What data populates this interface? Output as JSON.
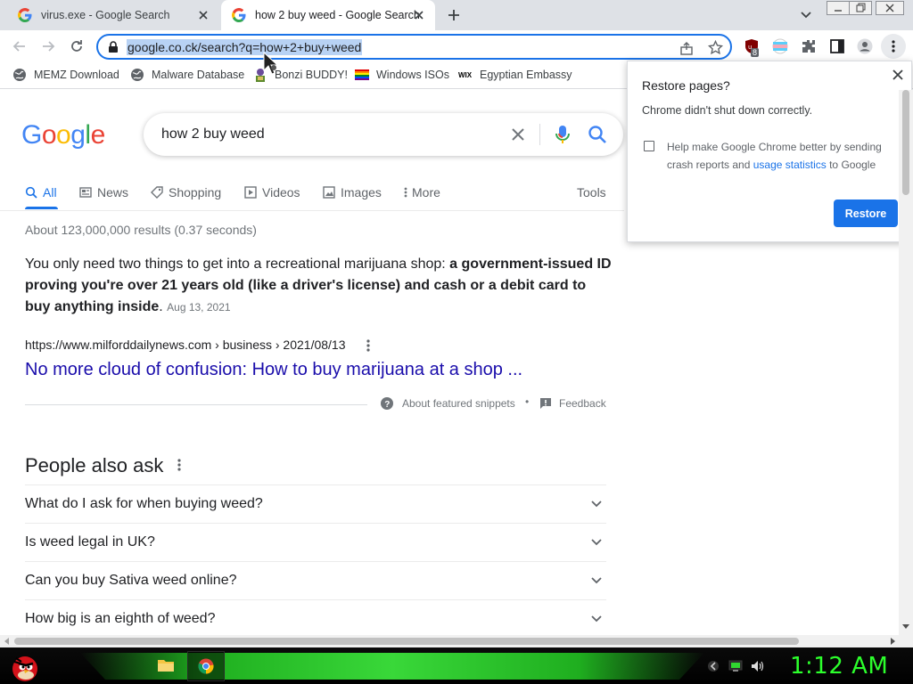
{
  "tabs": [
    {
      "title": "virus.exe - Google Search",
      "active": false
    },
    {
      "title": "how 2 buy weed - Google Search",
      "active": true
    }
  ],
  "omnibox": {
    "url": "google.co.ck/search?q=how+2+buy+weed"
  },
  "extensions": {
    "badge_count": "8"
  },
  "bookmarks": [
    {
      "label": "MEMZ Download",
      "icon": "globe-icon"
    },
    {
      "label": "Malware Database",
      "icon": "globe-icon"
    },
    {
      "label": "Bonzi BUDDY!",
      "icon": "bonzi-icon"
    },
    {
      "label": "Windows ISOs",
      "icon": "rainbow-flag-icon"
    },
    {
      "label": "Egyptian Embassy",
      "icon": "wix-icon"
    }
  ],
  "google": {
    "logo": "Google",
    "query": "how 2 buy weed",
    "tabs": [
      {
        "label": "All",
        "icon": "search-icon"
      },
      {
        "label": "News",
        "icon": "news-icon"
      },
      {
        "label": "Shopping",
        "icon": "tag-icon"
      },
      {
        "label": "Videos",
        "icon": "play-icon"
      },
      {
        "label": "Images",
        "icon": "image-icon"
      },
      {
        "label": "More",
        "icon": "more-vert-icon"
      }
    ],
    "tools_label": "Tools",
    "result_stats": "About 123,000,000 results (0.37 seconds)",
    "snippet": {
      "plain": "You only need two things to get into a recreational marijuana shop: ",
      "bold": "a government-issued ID proving you're over 21 years old (like a driver's license) and cash or a debit card to buy anything inside",
      "end": ".",
      "date": "Aug 13, 2021"
    },
    "result": {
      "cite": "https://www.milforddailynews.com › business › 2021/08/13",
      "title": "No more cloud of confusion: How to buy marijuana at a shop ..."
    },
    "about_snippets": "About featured snippets",
    "separator": "•",
    "feedback": "Feedback",
    "people_also_ask": {
      "title": "People also ask",
      "questions": [
        "What do I ask for when buying weed?",
        "Is weed legal in UK?",
        "Can you buy Sativa weed online?",
        "How big is an eighth of weed?"
      ]
    }
  },
  "restore_popup": {
    "title": "Restore pages?",
    "message": "Chrome didn't shut down correctly.",
    "help_prefix": "Help make Google Chrome better by sending crash reports and ",
    "help_link": "usage statistics",
    "help_suffix": " to Google",
    "checkbox_checked": false,
    "button": "Restore"
  },
  "taskbar": {
    "clock": "1:12 AM",
    "accent_color": "#2cff2c"
  },
  "colors": {
    "link": "#1a0dab",
    "accent": "#1a73e8",
    "selection": "#b8d2f4"
  }
}
